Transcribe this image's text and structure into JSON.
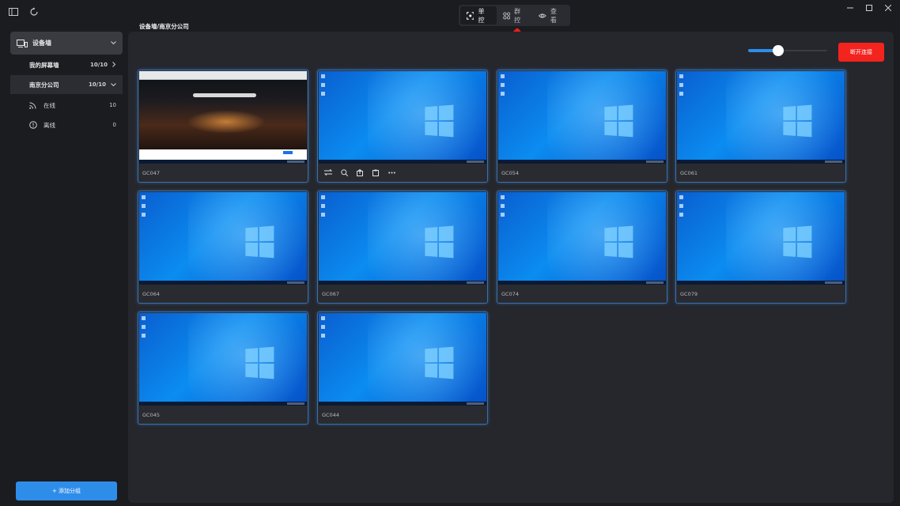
{
  "breadcrumb": "设备墙/南京分公司",
  "mode_tabs": [
    {
      "label": "单控",
      "icon": "target-icon",
      "active": true
    },
    {
      "label": "群控",
      "icon": "grid-icon",
      "active": false
    },
    {
      "label": "查看",
      "icon": "eye-icon",
      "active": false
    }
  ],
  "sidebar": {
    "header": {
      "label": "设备墙",
      "icon": "devices-icon"
    },
    "items": [
      {
        "label": "我的屏幕墙",
        "count": "10/10"
      },
      {
        "label": "南京分公司",
        "count": "10/10"
      }
    ],
    "sub_items": [
      {
        "label": "在线",
        "count": "10",
        "icon": "signal-icon"
      },
      {
        "label": "离线",
        "count": "0",
        "icon": "info-icon"
      }
    ],
    "add_button": "+ 添加分组"
  },
  "toolbar": {
    "zoom_level": 0.38,
    "disconnect_label": "断开连接"
  },
  "devices": [
    {
      "name": "GC047",
      "screen": "browser"
    },
    {
      "name": "",
      "screen": "desktop",
      "toolbar": true
    },
    {
      "name": "GC054",
      "screen": "desktop"
    },
    {
      "name": "GC061",
      "screen": "desktop"
    },
    {
      "name": "GC064",
      "screen": "desktop"
    },
    {
      "name": "GC067",
      "screen": "desktop"
    },
    {
      "name": "GC074",
      "screen": "desktop"
    },
    {
      "name": "GC079",
      "screen": "desktop"
    },
    {
      "name": "GC045",
      "screen": "desktop"
    },
    {
      "name": "GC044",
      "screen": "desktop"
    }
  ],
  "card_toolbar_icons": [
    "swap-icon",
    "zoom-icon",
    "upload-icon",
    "clipboard-icon",
    "more-icon"
  ],
  "colors": {
    "accent": "#2f8dea",
    "danger": "#f3231e",
    "background": "#1b1c20",
    "panel": "#26272c",
    "annotation": "#e8201c"
  }
}
